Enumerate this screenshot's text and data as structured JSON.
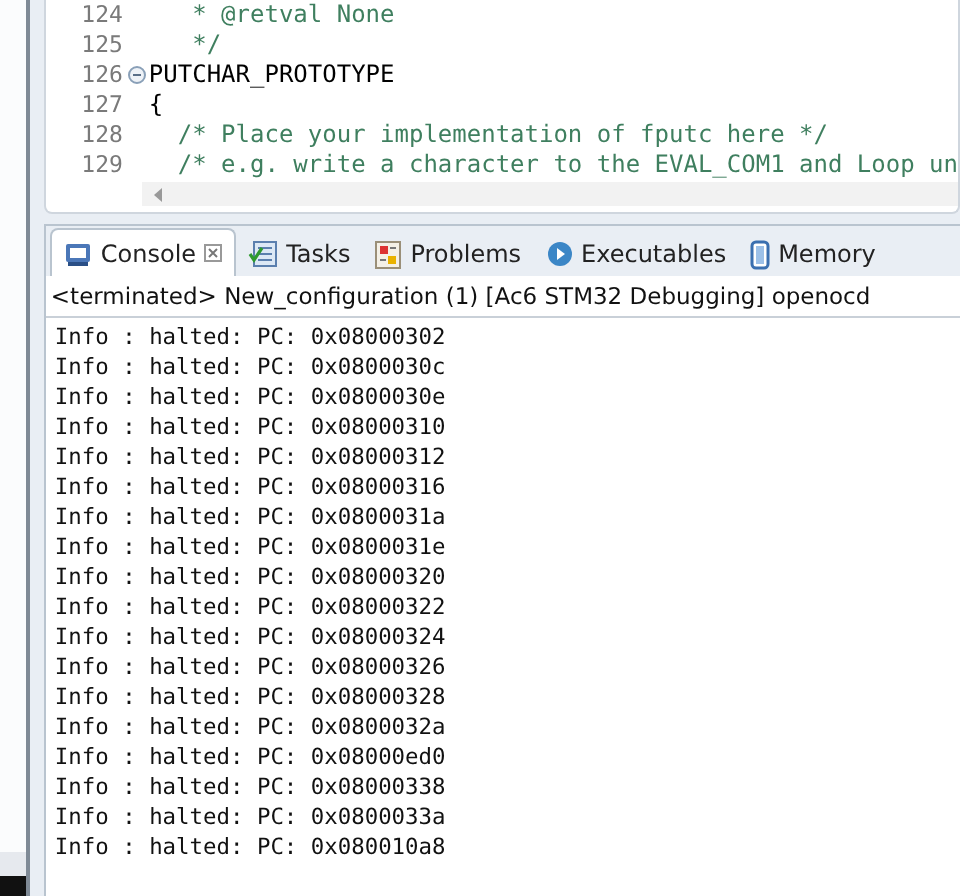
{
  "editor": {
    "lines": [
      {
        "number": "124",
        "text": "   * @retval None",
        "kind": "comment",
        "fold_marker": false
      },
      {
        "number": "125",
        "text": "   */",
        "kind": "comment",
        "fold_marker": false
      },
      {
        "number": "126",
        "text": "PUTCHAR_PROTOTYPE",
        "kind": "code",
        "fold_marker": true
      },
      {
        "number": "127",
        "text": "{",
        "kind": "code",
        "fold_marker": false
      },
      {
        "number": "128",
        "text": "  /* Place your implementation of fputc here */",
        "kind": "comment",
        "fold_marker": false
      },
      {
        "number": "129",
        "text": "  /* e.g. write a character to the EVAL_COM1 and Loop un",
        "kind": "comment",
        "fold_marker": false
      }
    ]
  },
  "console": {
    "tabs": [
      {
        "label": "Console",
        "kind": "console",
        "selected": true
      },
      {
        "label": "Tasks",
        "kind": "tasks",
        "selected": false
      },
      {
        "label": "Problems",
        "kind": "problems",
        "selected": false
      },
      {
        "label": "Executables",
        "kind": "executables",
        "selected": false
      },
      {
        "label": "Memory",
        "kind": "memory",
        "selected": false
      }
    ],
    "header": "<terminated> New_configuration (1) [Ac6 STM32 Debugging] openocd",
    "lines": [
      "Info : halted: PC: 0x08000302",
      "Info : halted: PC: 0x0800030c",
      "Info : halted: PC: 0x0800030e",
      "Info : halted: PC: 0x08000310",
      "Info : halted: PC: 0x08000312",
      "Info : halted: PC: 0x08000316",
      "Info : halted: PC: 0x0800031a",
      "Info : halted: PC: 0x0800031e",
      "Info : halted: PC: 0x08000320",
      "Info : halted: PC: 0x08000322",
      "Info : halted: PC: 0x08000324",
      "Info : halted: PC: 0x08000326",
      "Info : halted: PC: 0x08000328",
      "Info : halted: PC: 0x0800032a",
      "Info : halted: PC: 0x08000ed0",
      "Info : halted: PC: 0x08000338",
      "Info : halted: PC: 0x0800033a",
      "Info : halted: PC: 0x080010a8"
    ]
  }
}
